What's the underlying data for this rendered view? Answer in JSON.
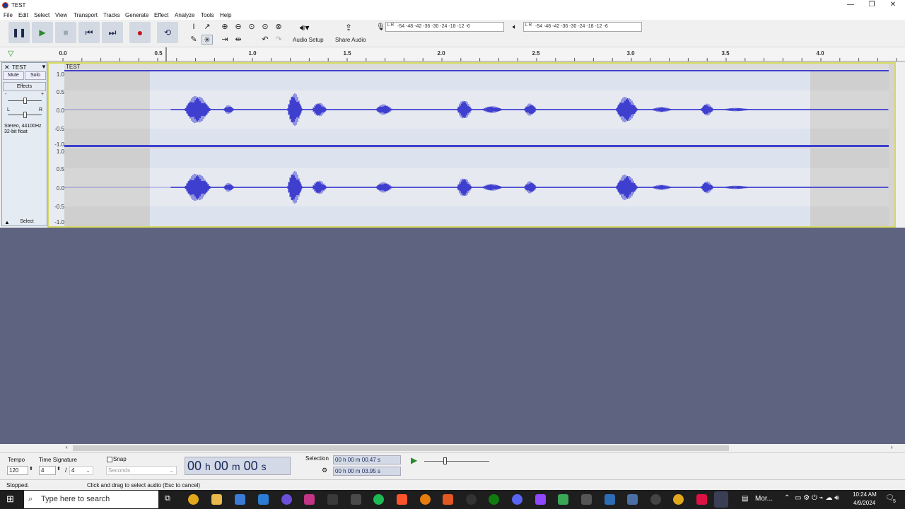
{
  "window": {
    "title": "TEST",
    "minimize": "—",
    "maximize": "❐",
    "close": "✕"
  },
  "menu": [
    "File",
    "Edit",
    "Select",
    "View",
    "Transport",
    "Tracks",
    "Generate",
    "Effect",
    "Analyze",
    "Tools",
    "Help"
  ],
  "toolbar": {
    "audio_setup_label": "Audio Setup",
    "share_audio_label": "Share Audio",
    "record_meter_scale": "-54 -48 -42 -36 -30 -24 -18 -12 -6",
    "play_meter_scale": "-54 -48 -42 -36 -30 -24 -18 -12 -6",
    "record_meter_lr": "L R",
    "play_meter_lr": "L R",
    "accent_record": "#c0141c",
    "accent_play": "#2a8a2a"
  },
  "ruler": {
    "ticks": [
      "0.0",
      "0.5",
      "1.0",
      "1.5",
      "2.0",
      "2.5",
      "3.0",
      "3.5",
      "4.0"
    ]
  },
  "track": {
    "name": "TEST",
    "mute_label": "Mute",
    "solo_label": "Solo",
    "effects_label": "Effects",
    "gain_minus": "-",
    "gain_plus": "+",
    "pan_left": "L",
    "pan_right": "R",
    "format_line1": "Stereo, 44100Hz",
    "format_line2": "32-bit float",
    "select_label": "Select",
    "scale_values": [
      "1.0",
      "0.5",
      "0.0",
      "-0.5",
      "-1.0"
    ],
    "waveform_color": "#3f3fcf",
    "clip_label": "TEST"
  },
  "bottom": {
    "tempo_label": "Tempo",
    "tempo_value": "120",
    "time_signature_label": "Time Signature",
    "ts_numerator": "4",
    "ts_separator": "/",
    "ts_denominator": "4",
    "snap_label": "Snap",
    "snap_unit": "Seconds",
    "time_h": "00",
    "time_h_unit": "h",
    "time_m": "00",
    "time_m_unit": "m",
    "time_s": "00",
    "time_s_unit": "s",
    "selection_label": "Selection",
    "selection_start": "00 h 00 m 00.47 s",
    "selection_end": "00 h 00 m 03.95 s"
  },
  "status": {
    "state": "Stopped.",
    "hint": "Click and drag to select audio (Esc to cancel)"
  },
  "taskbar": {
    "search_placeholder": "Type here to search",
    "app_label": "Mor...",
    "time": "10:24 AM",
    "date": "4/9/2024",
    "notification_count": "5"
  }
}
